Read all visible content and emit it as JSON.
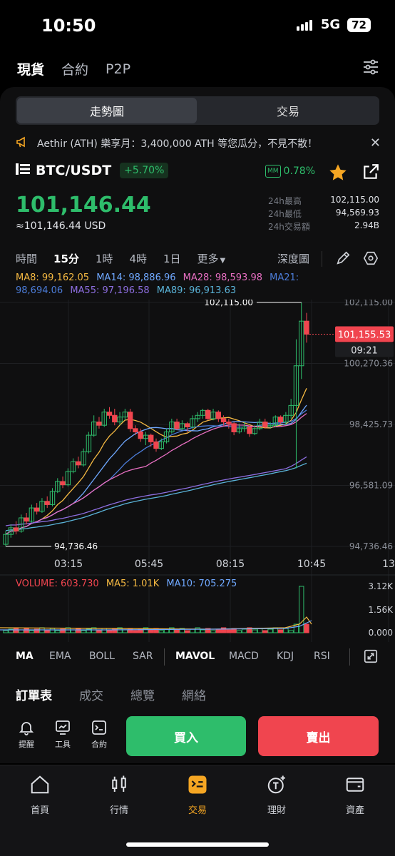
{
  "status": {
    "time": "10:50",
    "network": "5G",
    "battery": "72"
  },
  "top_tabs": [
    "現貨",
    "合約",
    "P2P"
  ],
  "segment": {
    "chart": "走勢圖",
    "trade": "交易"
  },
  "announcement": "Aethir (ATH) 樂享月：3,400,000 ATH 等您瓜分，不見不散！",
  "pair": {
    "symbol": "BTC/USDT",
    "change": "+5.70%",
    "mm_label": "MM",
    "mm_value": "0.78%"
  },
  "price": {
    "last": "101,146.44",
    "usd": "≈101,146.44 USD"
  },
  "stats": [
    {
      "label": "24h最高",
      "value": "102,115.00"
    },
    {
      "label": "24h最低",
      "value": "94,569.93"
    },
    {
      "label": "24h交易額",
      "value": "2.94B"
    }
  ],
  "intervals": [
    "時間",
    "15分",
    "1時",
    "4時",
    "1日",
    "更多"
  ],
  "depth_label": "深度圖",
  "ma_legend": {
    "ma8": "MA8: 99,162.05",
    "ma14": "MA14: 98,886.96",
    "ma28": "MA28: 98,593.98",
    "ma21": "MA21:",
    "ma21_val": "98,694.06",
    "ma55": "MA55: 97,196.58",
    "ma89": "MA89: 96,913.63"
  },
  "colors": {
    "ma8": "#f5b942",
    "ma14": "#6fa8ff",
    "ma28": "#e86fc2",
    "ma21": "#4c7dd9",
    "ma55": "#8d6ee0",
    "ma89": "#5ab3d8",
    "up": "#2ebd6b",
    "down": "#f0454f"
  },
  "chart_data": {
    "type": "candlestick",
    "y_ticks": [
      "102,115.00",
      "100,270.36",
      "98,425.73",
      "96,581.09",
      "94,736.46"
    ],
    "x_ticks": [
      "03:15",
      "05:45",
      "08:15",
      "10:45",
      "13"
    ],
    "ylim": [
      94736.46,
      102115.0
    ],
    "high_marker": "102,115.00",
    "low_marker": "94,736.46",
    "current_price_label": "101,155.53",
    "countdown": "09:21",
    "candles": [
      [
        94800,
        95100,
        94736,
        95200
      ],
      [
        95100,
        95300,
        95000,
        95400
      ],
      [
        95300,
        95200,
        95100,
        95500
      ],
      [
        95200,
        95600,
        95150,
        95700
      ],
      [
        95600,
        95500,
        95400,
        95750
      ],
      [
        95500,
        95900,
        95450,
        96000
      ],
      [
        95900,
        95800,
        95700,
        96050
      ],
      [
        95800,
        96100,
        95750,
        96200
      ],
      [
        96100,
        96000,
        95900,
        96250
      ],
      [
        96000,
        96400,
        95950,
        96500
      ],
      [
        96400,
        96700,
        96350,
        96800
      ],
      [
        96700,
        96600,
        96500,
        96850
      ],
      [
        96600,
        97000,
        96550,
        97100
      ],
      [
        97000,
        97300,
        96950,
        97400
      ],
      [
        97300,
        97200,
        97100,
        97450
      ],
      [
        97200,
        97600,
        97150,
        97700
      ],
      [
        97600,
        98100,
        97550,
        98200
      ],
      [
        98100,
        98500,
        98050,
        98700
      ],
      [
        98500,
        98400,
        98300,
        98650
      ],
      [
        98400,
        98800,
        98350,
        98900
      ],
      [
        98800,
        98700,
        98600,
        98950
      ],
      [
        98700,
        98500,
        98400,
        98900
      ],
      [
        98500,
        98650,
        98400,
        98800
      ],
      [
        98650,
        98800,
        98550,
        98900
      ],
      [
        98800,
        98300,
        98200,
        98900
      ],
      [
        98300,
        98200,
        98100,
        98400
      ],
      [
        98200,
        98000,
        97900,
        98300
      ],
      [
        98000,
        98100,
        97800,
        98200
      ],
      [
        98100,
        97900,
        97750,
        98150
      ],
      [
        97900,
        97700,
        97600,
        98000
      ],
      [
        97700,
        97900,
        97650,
        98000
      ],
      [
        97900,
        98200,
        97850,
        98300
      ],
      [
        98200,
        98500,
        98150,
        98600
      ],
      [
        98500,
        98300,
        98250,
        98600
      ],
      [
        98300,
        98450,
        98250,
        98550
      ],
      [
        98450,
        98350,
        98200,
        98500
      ],
      [
        98350,
        98600,
        98300,
        98700
      ],
      [
        98600,
        98700,
        98500,
        98800
      ],
      [
        98700,
        98850,
        98600,
        98900
      ],
      [
        98850,
        98600,
        98550,
        98900
      ],
      [
        98600,
        98800,
        98550,
        98900
      ],
      [
        98800,
        98600,
        98500,
        98850
      ],
      [
        98600,
        98500,
        98400,
        98700
      ],
      [
        98500,
        98450,
        98300,
        98600
      ],
      [
        98450,
        98200,
        98100,
        98500
      ],
      [
        98200,
        98300,
        98150,
        98450
      ],
      [
        98300,
        98350,
        98200,
        98500
      ],
      [
        98350,
        98150,
        98050,
        98400
      ],
      [
        98150,
        98300,
        98100,
        98400
      ],
      [
        98300,
        98500,
        98250,
        98600
      ],
      [
        98500,
        98350,
        98300,
        98600
      ],
      [
        98350,
        98400,
        98300,
        98500
      ],
      [
        98400,
        98650,
        98350,
        98700
      ],
      [
        98650,
        98500,
        98450,
        98700
      ],
      [
        98500,
        98700,
        98400,
        98800
      ],
      [
        98700,
        99000,
        98600,
        99200
      ],
      [
        99000,
        100200,
        97100,
        101000
      ],
      [
        100200,
        101550,
        99800,
        102115
      ],
      [
        101550,
        101155,
        100900,
        101800
      ]
    ],
    "volume_ticks": [
      "3.12K",
      "1.56K",
      "0.000"
    ],
    "volume_legend": {
      "volume": "VOLUME: 603.730",
      "ma5": "MA5: 1.01K",
      "ma10": "MA10: 705.275"
    }
  },
  "indicators": [
    "MA",
    "EMA",
    "BOLL",
    "SAR",
    "MAVOL",
    "MACD",
    "KDJ",
    "RSI"
  ],
  "order_tabs": [
    "訂單表",
    "成交",
    "總覽",
    "網絡"
  ],
  "tools": [
    "提醒",
    "工具",
    "合約"
  ],
  "actions": {
    "buy": "買入",
    "sell": "賣出"
  },
  "tabbar": [
    "首頁",
    "行情",
    "交易",
    "理財",
    "資產"
  ]
}
